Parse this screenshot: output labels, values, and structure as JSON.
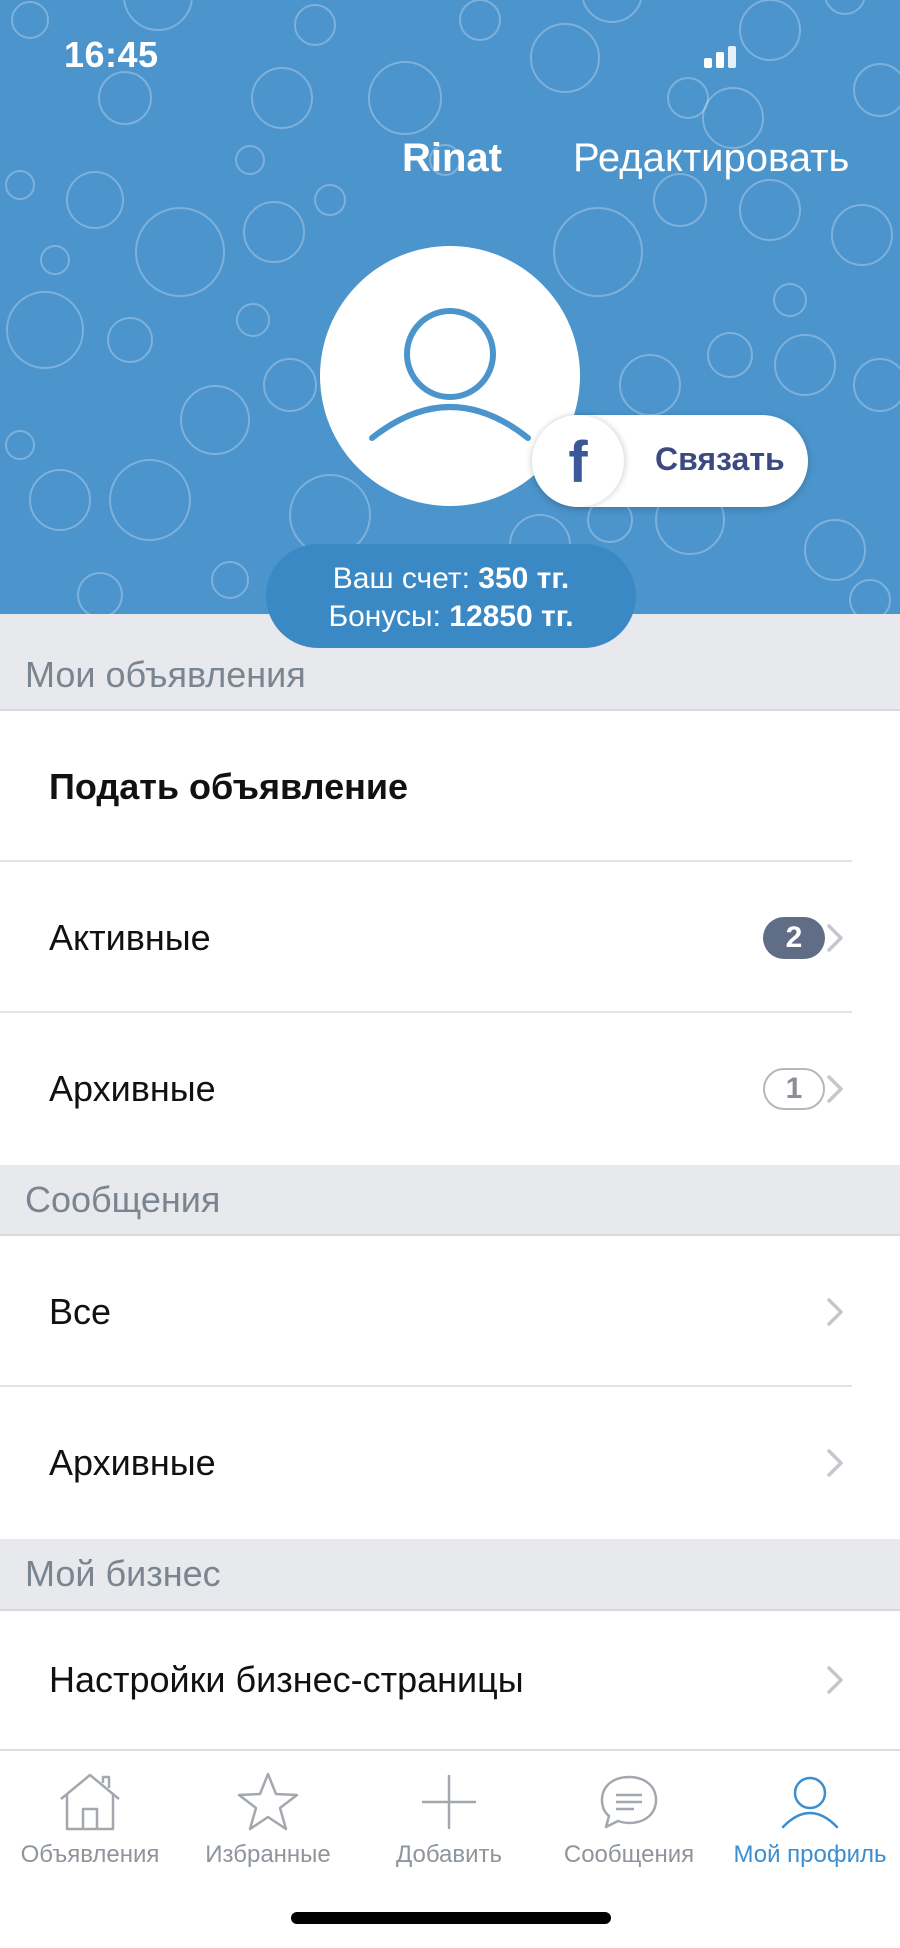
{
  "status_bar": {
    "time": "16:45"
  },
  "header": {
    "name": "Rinat",
    "edit_label": "Редактировать",
    "facebook_letter": "f",
    "facebook_connect_label": "Связать",
    "balance": {
      "account_label": "Ваш счет:",
      "account_value": "350 тг.",
      "bonus_label": "Бонусы:",
      "bonus_value": "12850 тг."
    }
  },
  "sections": {
    "ads": {
      "title": "Мои объявления",
      "submit": "Подать объявление",
      "active": {
        "label": "Активные",
        "count": "2"
      },
      "archived": {
        "label": "Архивные",
        "count": "1"
      }
    },
    "messages": {
      "title": "Сообщения",
      "all": "Все",
      "archived": "Архивные"
    },
    "business": {
      "title": "Мой бизнес",
      "settings": "Настройки бизнес-страницы"
    }
  },
  "tabbar": {
    "tabs": [
      {
        "label": "Объявления",
        "icon": "home-icon",
        "active": false
      },
      {
        "label": "Избранные",
        "icon": "star-icon",
        "active": false
      },
      {
        "label": "Добавить",
        "icon": "plus-icon",
        "active": false
      },
      {
        "label": "Сообщения",
        "icon": "chat-bubble-icon",
        "active": false
      },
      {
        "label": "Мой профиль",
        "icon": "profile-icon",
        "active": true
      }
    ]
  },
  "colors": {
    "header_blue": "#4b94cc",
    "balance_blue": "#3a88c4",
    "accent": "#3b8ed0",
    "badge_filled": "#5f6d86",
    "section_bg": "#e8e9ec"
  }
}
